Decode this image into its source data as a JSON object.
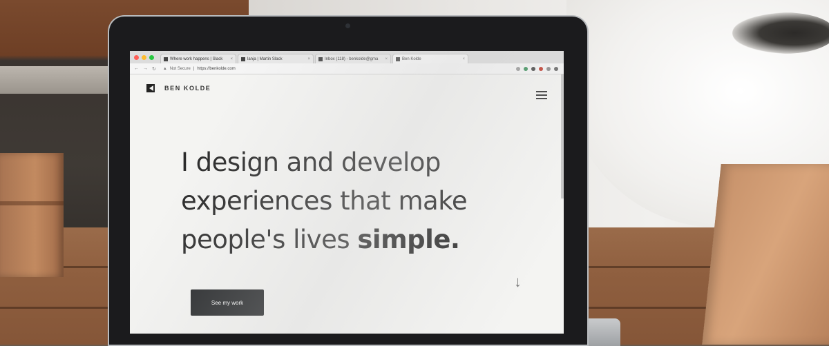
{
  "browser": {
    "tabs": [
      {
        "label": "Where work happens | Slack",
        "active": false
      },
      {
        "label": "lanja | Martin Slack",
        "active": false
      },
      {
        "label": "Inbox (118) - benkolde@gma",
        "active": false
      },
      {
        "label": "Ben Kolde",
        "active": true
      }
    ],
    "security_label": "Not Secure",
    "url": "https://benkolde.com",
    "traffic_colors": [
      "#ff5f57",
      "#febc2e",
      "#28c840"
    ]
  },
  "site": {
    "brand": "BEN KOLDE",
    "hero_line1": "I design and develop",
    "hero_line2": "experiences that make",
    "hero_line3_prefix": "people's lives ",
    "hero_line3_emphasis": "simple.",
    "cta_label": "See my work",
    "scroll_arrow": "↓"
  },
  "colors": {
    "button_bg": "#222426",
    "page_bg": "#f4f4f2",
    "text": "#2a2a2a"
  }
}
